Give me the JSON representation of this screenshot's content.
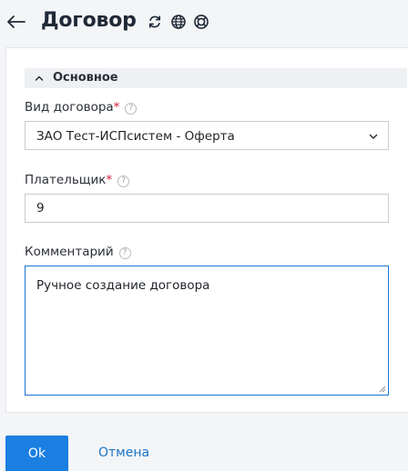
{
  "header": {
    "title": "Договор",
    "icons": [
      "back-arrow-icon",
      "refresh-icon",
      "globe-icon",
      "lifebuoy-icon"
    ]
  },
  "section": {
    "label": "Основное",
    "icon": "chevron-up-icon"
  },
  "fields": {
    "contract_type": {
      "label": "Вид договора",
      "required_mark": "*",
      "help": "?",
      "value": "ЗАО Тест-ИСПсистем - Оферта"
    },
    "payer": {
      "label": "Плательщик",
      "required_mark": "*",
      "help": "?",
      "value": "9"
    },
    "comment": {
      "label": "Комментарий",
      "help": "?",
      "value": "Ручное создание договора"
    }
  },
  "actions": {
    "ok_label": "Ok",
    "cancel_label": "Отмена"
  },
  "colors": {
    "primary": "#1a7fe0",
    "link": "#1a73c8",
    "required": "#d0213a",
    "focus_border": "#1976d2"
  }
}
